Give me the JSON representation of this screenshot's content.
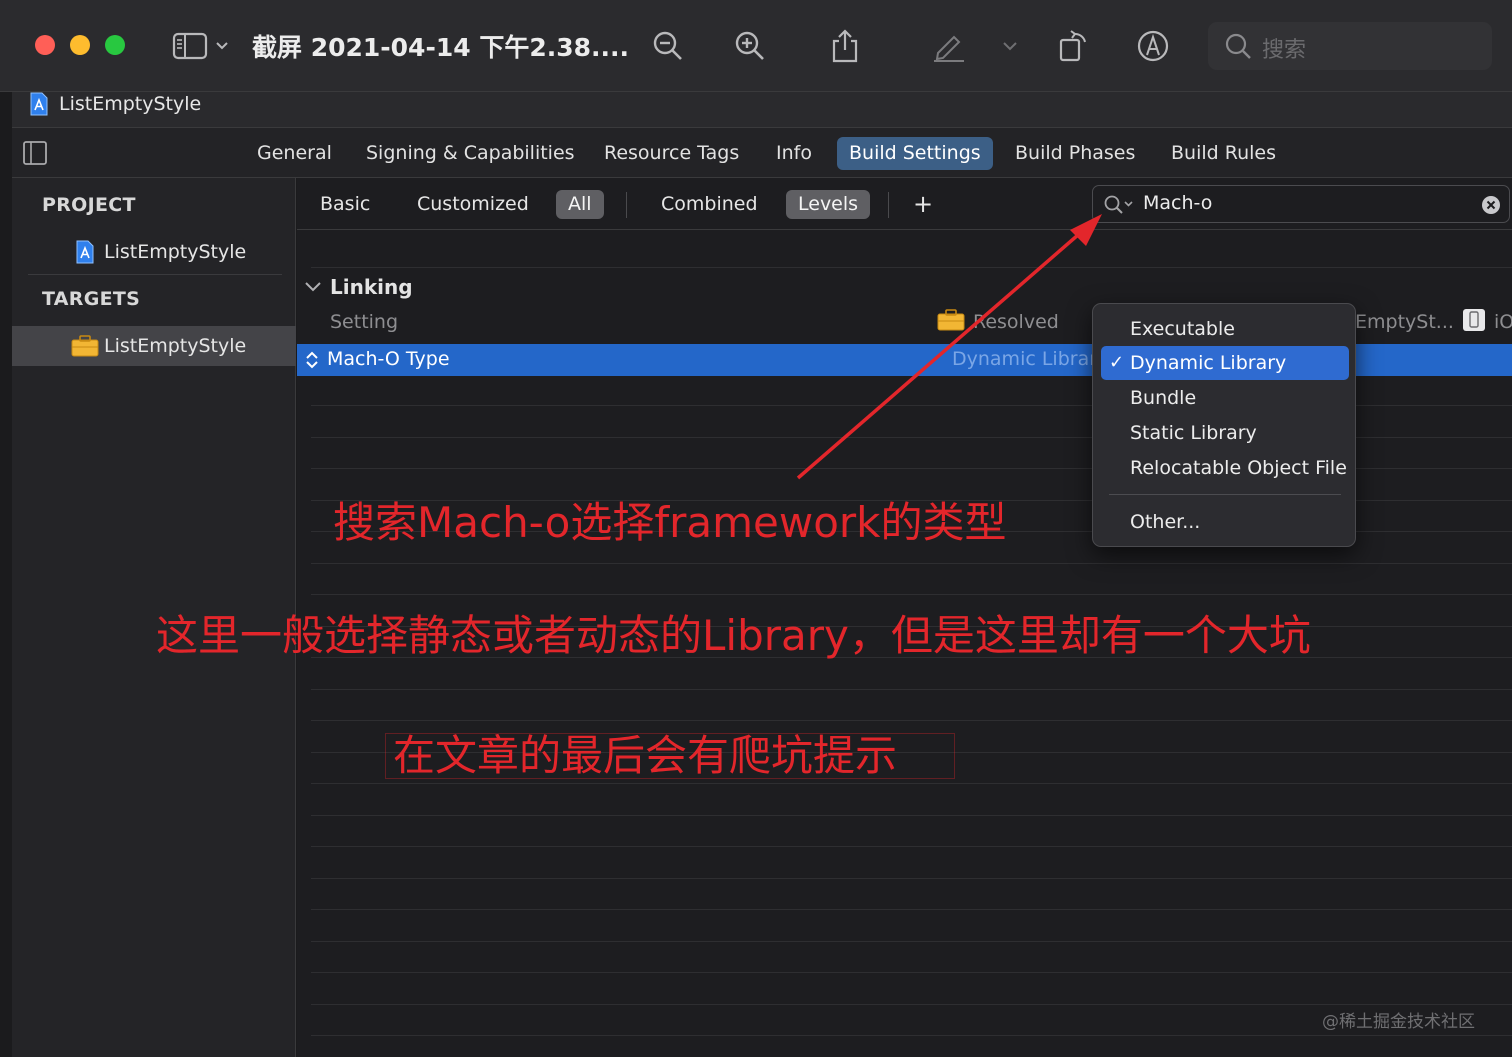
{
  "window": {
    "title": "截屏 2021-04-14 下午2.38....",
    "search_placeholder": "搜索"
  },
  "file": {
    "name": "ListEmptyStyle"
  },
  "tabs": [
    {
      "label": "General"
    },
    {
      "label": "Signing & Capabilities"
    },
    {
      "label": "Resource Tags"
    },
    {
      "label": "Info"
    },
    {
      "label": "Build Settings",
      "active": true
    },
    {
      "label": "Build Phases"
    },
    {
      "label": "Build Rules"
    }
  ],
  "sidebar": {
    "project_header": "PROJECT",
    "project_item": "ListEmptyStyle",
    "targets_header": "TARGETS",
    "target_item": "ListEmptyStyle"
  },
  "filter": {
    "basic": "Basic",
    "customized": "Customized",
    "all": "All",
    "combined": "Combined",
    "levels": "Levels",
    "add": "+",
    "search_value": "Mach-o"
  },
  "section": {
    "title": "Linking",
    "col_setting": "Setting",
    "col_resolved": "Resolved",
    "col_target": "EmptySt...",
    "col_ios": "iO"
  },
  "selected_row": {
    "label": "Mach-O Type",
    "value": "Dynamic Library"
  },
  "menu": {
    "items": [
      "Executable",
      "Dynamic Library",
      "Bundle",
      "Static Library",
      "Relocatable Object File"
    ],
    "checked": "Dynamic Library",
    "check_glyph": "✓",
    "other": "Other..."
  },
  "annotations": {
    "line1": "搜索Mach-o选择framework的类型",
    "line2": "这里一般选择静态或者动态的Library，但是这里却有一个大坑",
    "line3": "在文章的最后会有爬坑提示"
  },
  "watermark": "@稀土掘金技术社区",
  "colors": {
    "accent": "#2467c9",
    "annotation": "#e3262b",
    "traffic_red": "#ff5f57",
    "traffic_yellow": "#febc2e",
    "traffic_green": "#28c840"
  }
}
